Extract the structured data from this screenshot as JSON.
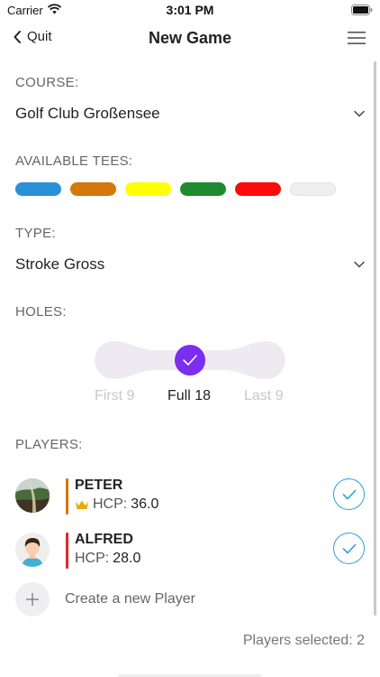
{
  "status_bar": {
    "carrier": "Carrier",
    "time": "3:01 PM"
  },
  "nav": {
    "back_label": "Quit",
    "title": "New Game"
  },
  "course": {
    "label": "COURSE:",
    "value": "Golf Club Großensee"
  },
  "tees": {
    "label": "AVAILABLE TEES:",
    "colors": [
      "#2992d6",
      "#d4780c",
      "#ffff00",
      "#1f8a2e",
      "#ff0a0a",
      "#efefef"
    ]
  },
  "type": {
    "label": "TYPE:",
    "value": "Stroke Gross"
  },
  "holes": {
    "label": "HOLES:",
    "options": [
      "First 9",
      "Full 18",
      "Last 9"
    ],
    "selected": "Full 18",
    "accent": "#7b2df0"
  },
  "players": {
    "label": "PLAYERS:",
    "items": [
      {
        "name": "PETER",
        "hcp_label": "HCP:",
        "hcp": "36.0",
        "bar_color": "#d4780c",
        "crown": true,
        "selected": true
      },
      {
        "name": "ALFRED",
        "hcp_label": "HCP:",
        "hcp": "28.0",
        "bar_color": "#e0282c",
        "crown": false,
        "selected": true
      }
    ],
    "create_label": "Create a new Player",
    "selected_text": "Players selected: 2"
  },
  "icons": {
    "back": "chevron-left-icon",
    "menu": "hamburger-icon",
    "dropdown": "chevron-down-icon",
    "check": "check-icon",
    "add": "plus-icon",
    "crown": "crown-icon"
  }
}
